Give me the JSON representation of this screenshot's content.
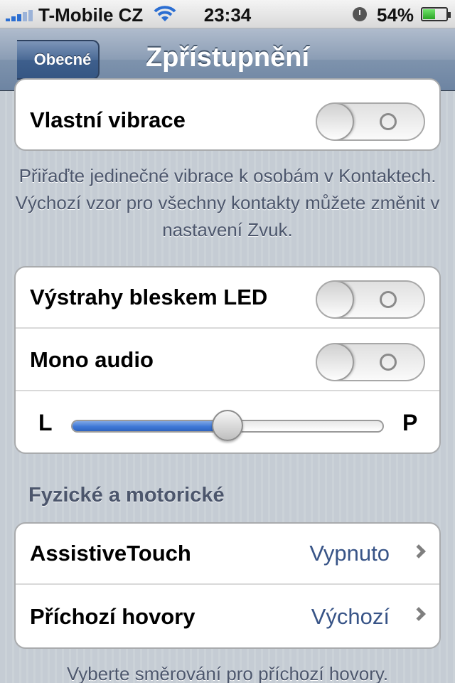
{
  "status_bar": {
    "carrier": "T-Mobile CZ",
    "time": "23:34",
    "battery": "54%",
    "battery_level": 0.54
  },
  "nav": {
    "back_label": "Obecné",
    "title": "Zpřístupnění"
  },
  "group1": {
    "rows": [
      {
        "label": "Vlastní vibrace",
        "toggle_on": false
      }
    ],
    "footnote": "Přiřaďte jedinečné vibrace k osobám v Kontaktech. Výchozí vzor pro všechny kontakty můžete změnit v nastavení Zvuk."
  },
  "group2": {
    "rows": [
      {
        "label": "Výstrahy bleskem LED",
        "toggle_on": false
      },
      {
        "label": "Mono audio",
        "toggle_on": false
      }
    ],
    "balance": {
      "left_label": "L",
      "right_label": "P",
      "value": 0.5
    }
  },
  "section_physical": {
    "header": "Fyzické a motorické",
    "rows": [
      {
        "label": "AssistiveTouch",
        "value": "Vypnuto"
      },
      {
        "label": "Příchozí hovory",
        "value": "Výchozí"
      }
    ],
    "footnote": "Vyberte směrování pro příchozí hovory."
  },
  "colors": {
    "accent_blue": "#385487",
    "slider_blue": "#3f78d6",
    "nav_bar": "#6d84a2"
  }
}
